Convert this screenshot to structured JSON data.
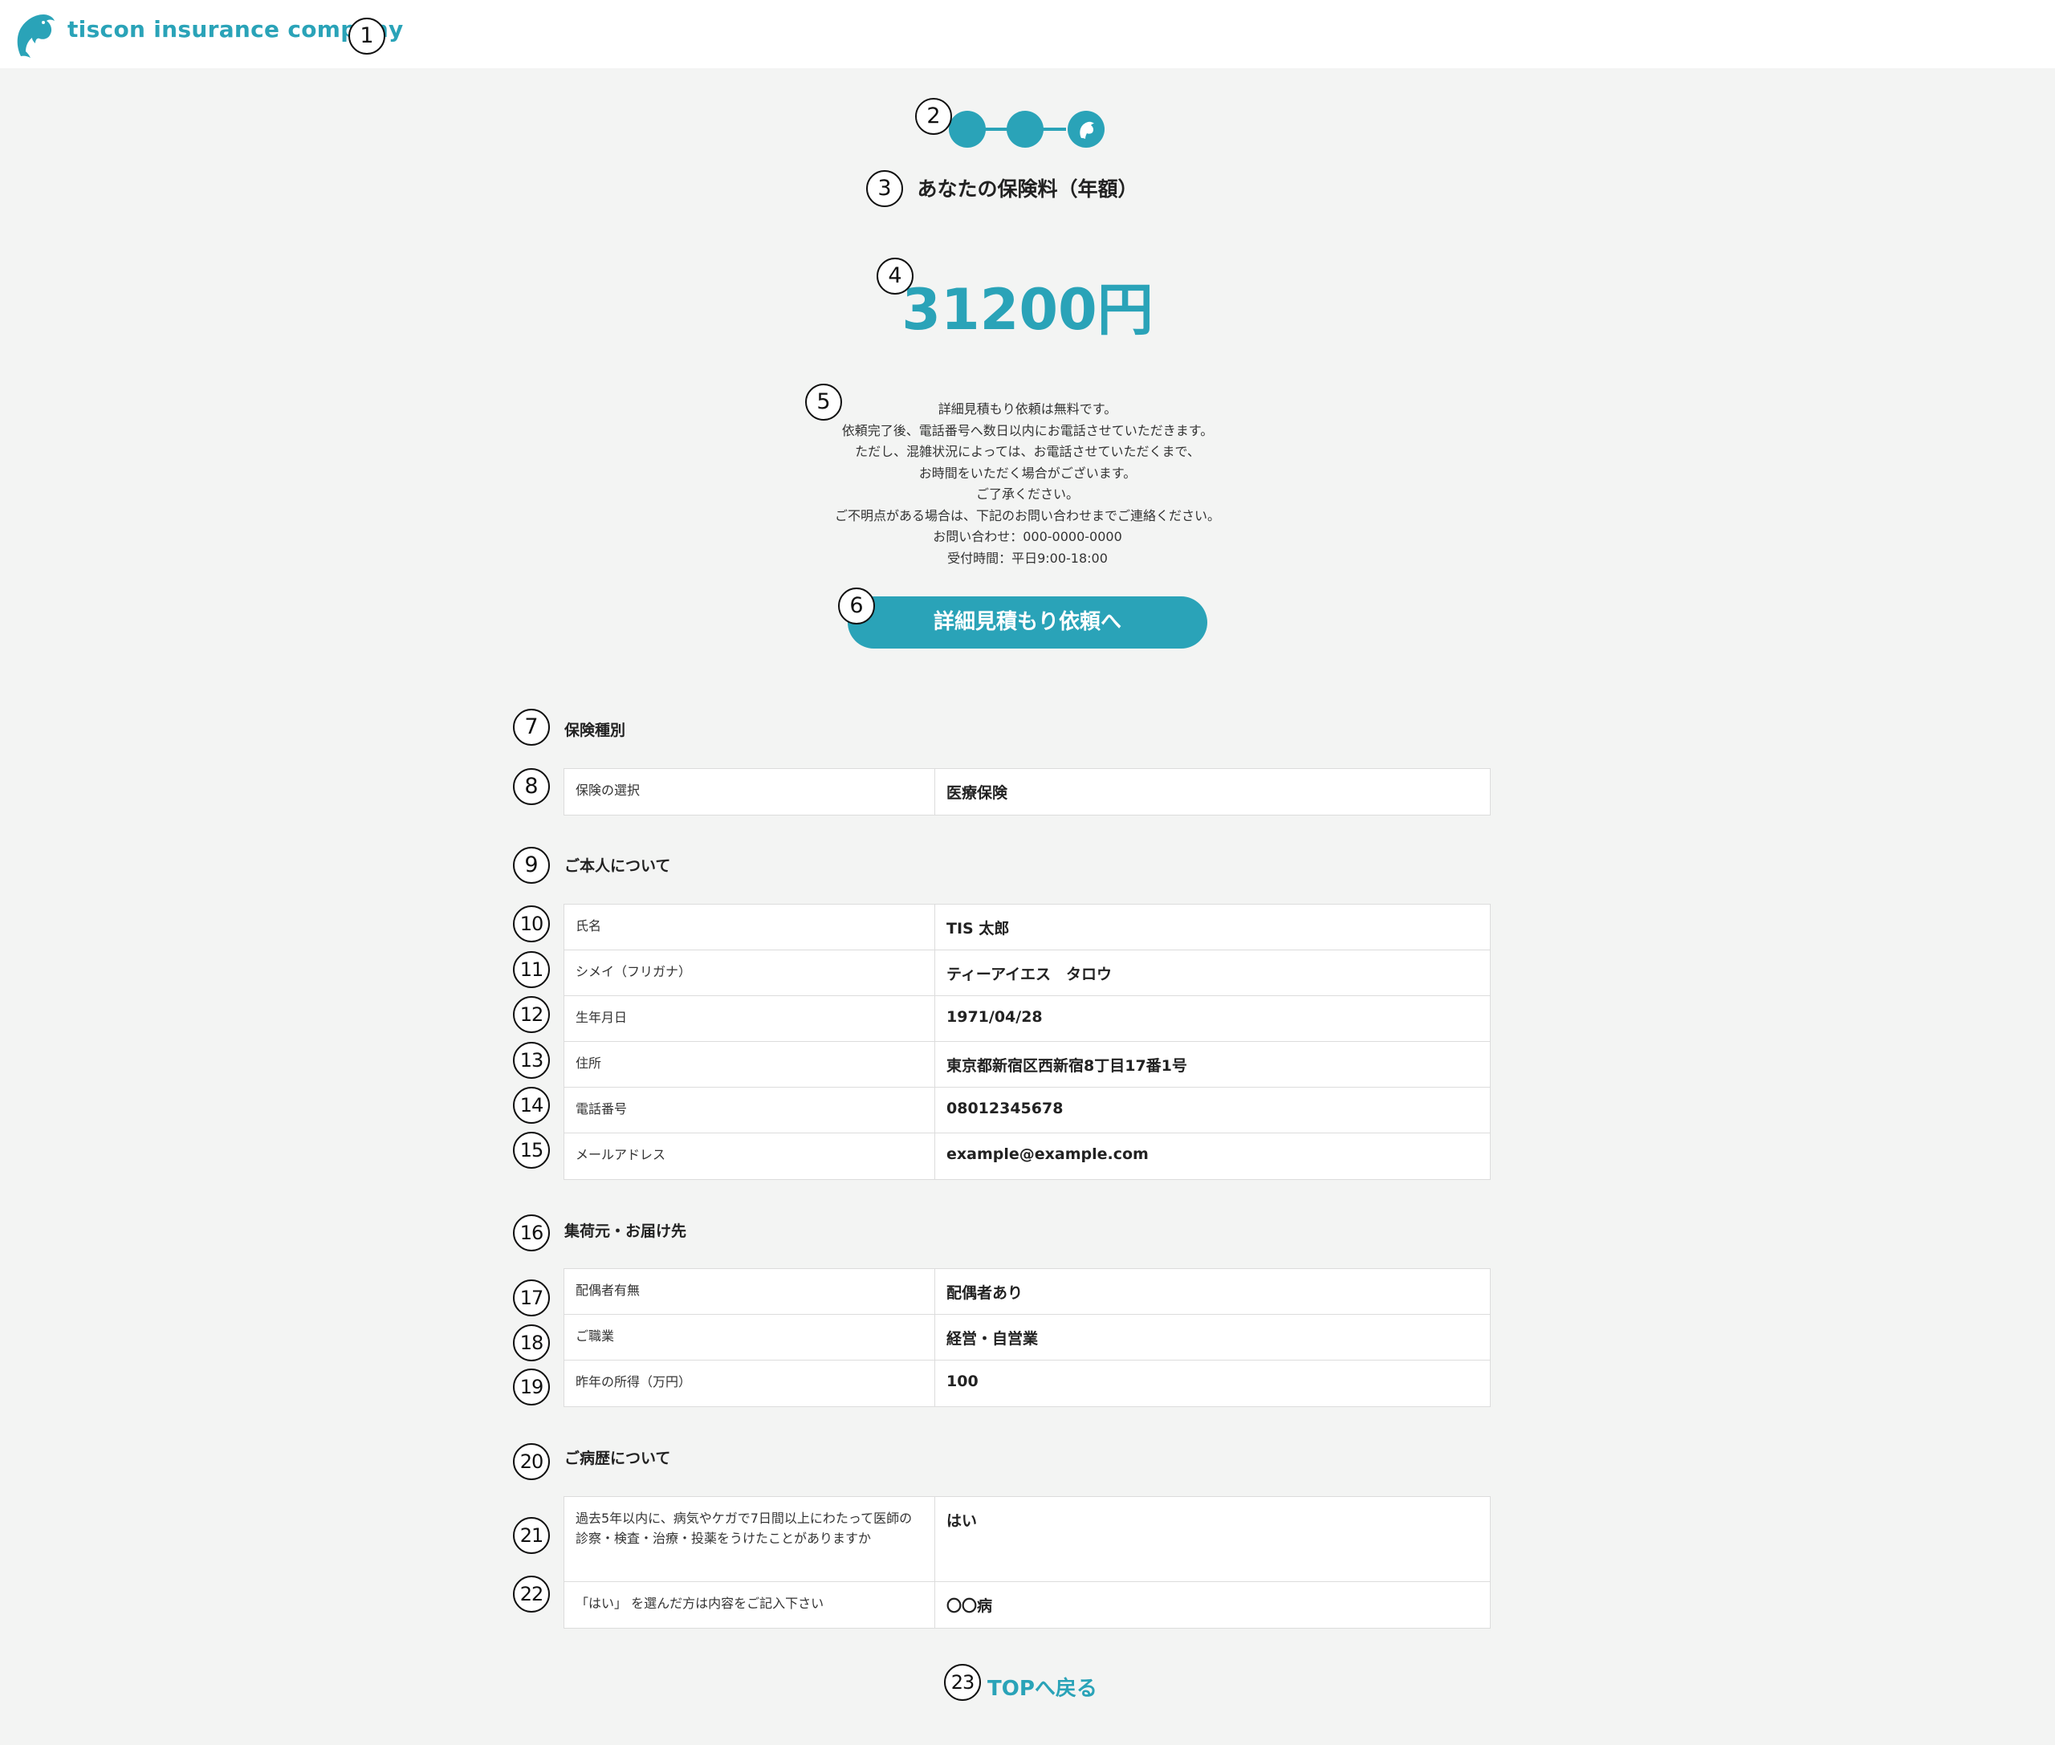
{
  "header": {
    "company_name": "tiscon insurance company"
  },
  "markers": [
    "1",
    "2",
    "3",
    "4",
    "5",
    "6",
    "7",
    "8",
    "9",
    "10",
    "11",
    "12",
    "13",
    "14",
    "15",
    "16",
    "17",
    "18",
    "19",
    "20",
    "21",
    "22",
    "23"
  ],
  "steps": {
    "total": 3,
    "current": 3
  },
  "result": {
    "title": "あなたの保険料（年額）",
    "price": "31200円"
  },
  "notice": {
    "lines": [
      "詳細見積もり依頼は無料です。",
      "依頼完了後、電話番号へ数日以内にお電話させていただきます。",
      "ただし、混雑状況によっては、お電話させていただくまで、",
      "お時間をいただく場合がございます。",
      "ご了承ください。",
      "ご不明点がある場合は、下記のお問い合わせまでご連絡ください。",
      "お問い合わせ：000-0000-0000",
      "受付時間：平日9:00-18:00"
    ]
  },
  "cta_button": "詳細見積もり依頼へ",
  "sections": {
    "insurance_type": {
      "title": "保険種別",
      "rows": [
        {
          "label": "保険の選択",
          "value": "医療保険"
        }
      ]
    },
    "personal": {
      "title": "ご本人について",
      "rows": [
        {
          "label": "氏名",
          "value": "TIS 太郎"
        },
        {
          "label": "シメイ（フリガナ）",
          "value": "ティーアイエス　タロウ"
        },
        {
          "label": "生年月日",
          "value": "1971/04/28"
        },
        {
          "label": "住所",
          "value": "東京都新宿区西新宿8丁目17番1号"
        },
        {
          "label": "電話番号",
          "value": "08012345678"
        },
        {
          "label": "メールアドレス",
          "value": "example@example.com"
        }
      ]
    },
    "pickup": {
      "title": "集荷元・お届け先",
      "rows": [
        {
          "label": "配偶者有無",
          "value": "配偶者あり"
        },
        {
          "label": "ご職業",
          "value": "経営・自営業"
        },
        {
          "label": "昨年の所得（万円）",
          "value": "100"
        }
      ]
    },
    "medical": {
      "title": "ご病歴について",
      "rows": [
        {
          "label": "過去5年以内に、病気やケガで7日間以上にわたって医師の診察・検査・治療・投薬をうけたことがありますか",
          "value": "はい"
        },
        {
          "label": "「はい」 を選んだ方は内容をご記入下さい",
          "value": "〇〇病"
        }
      ]
    }
  },
  "footer_link": "TOPへ戻る",
  "colors": {
    "accent": "#2aa3b8",
    "background": "#f3f4f3",
    "header_bg": "#ffffff",
    "table_border": "#dcdcdc"
  }
}
